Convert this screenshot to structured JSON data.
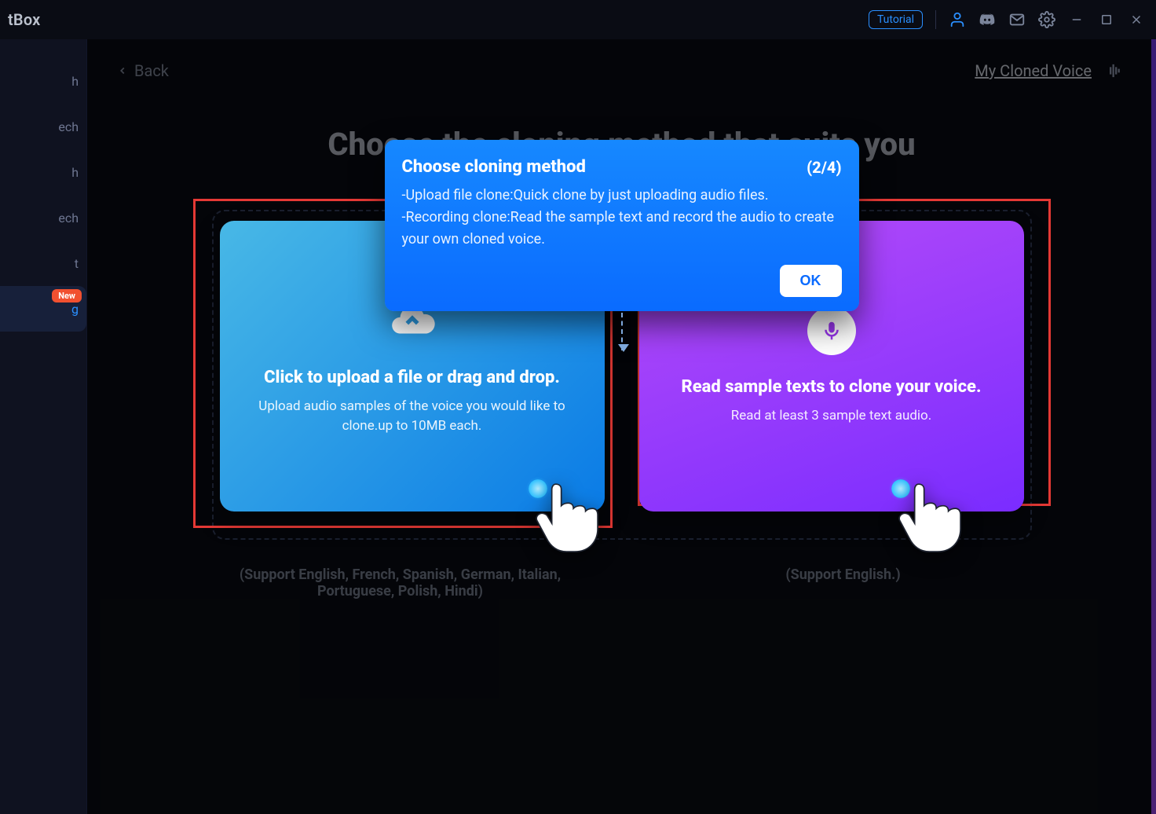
{
  "titlebar": {
    "app_title": "tBox",
    "tutorial_label": "Tutorial"
  },
  "sidebar": {
    "items": [
      {
        "label": "h"
      },
      {
        "label": "ech"
      },
      {
        "label": "h"
      },
      {
        "label": "ech"
      },
      {
        "label": "t"
      },
      {
        "label": "g",
        "badge": "New",
        "active": true
      }
    ]
  },
  "page": {
    "back_label": "Back",
    "my_cloned_voice": "My Cloned Voice",
    "title": "Choose the cloning method that suits you"
  },
  "cards": {
    "upload": {
      "title": "Click to upload a file or drag and drop.",
      "subtitle": "Upload audio samples of the voice you would like to clone.up to 10MB each.",
      "support": "(Support English, French, Spanish, German, Italian, Portuguese, Polish, Hindi)"
    },
    "record": {
      "title": "Read sample texts to clone your voice.",
      "subtitle": "Read at least 3 sample text audio.",
      "support": "(Support English.)"
    }
  },
  "popover": {
    "title": "Choose cloning method",
    "step": "(2/4)",
    "body_line1": "-Upload file clone:Quick clone by just uploading audio files.",
    "body_line2": "-Recording clone:Read the sample text and record the audio to create your own cloned voice.",
    "ok_label": "OK"
  }
}
